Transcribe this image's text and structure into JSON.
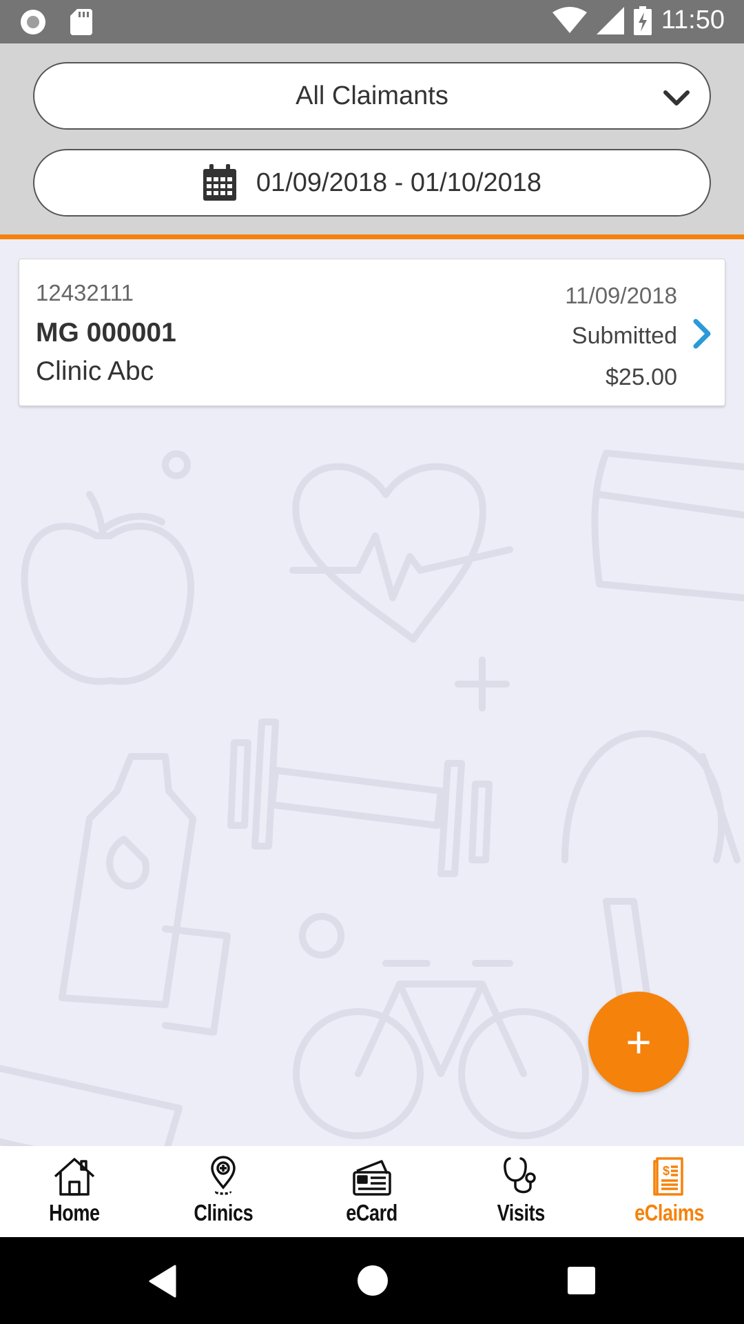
{
  "status_bar": {
    "time": "11:50",
    "left_icons": [
      "record-icon",
      "sd-card-icon"
    ],
    "right_icons": [
      "wifi-icon",
      "signal-icon",
      "battery-charging-icon"
    ]
  },
  "filters": {
    "claimant_selected": "All Claimants",
    "date_range": "01/09/2018 - 01/10/2018"
  },
  "claims": [
    {
      "number": "12432111",
      "code": "MG 000001",
      "clinic": "Clinic Abc",
      "date": "11/09/2018",
      "status": "Submitted",
      "amount": "$25.00"
    }
  ],
  "fab": {
    "label": "+"
  },
  "tabs": [
    {
      "label": "Home",
      "icon": "home-icon",
      "active": false
    },
    {
      "label": "Clinics",
      "icon": "map-pin-icon",
      "active": false
    },
    {
      "label": "eCard",
      "icon": "ecard-icon",
      "active": false
    },
    {
      "label": "Visits",
      "icon": "stethoscope-icon",
      "active": false
    },
    {
      "label": "eClaims",
      "icon": "eclaims-icon",
      "active": true
    }
  ],
  "colors": {
    "accent": "#f5820b",
    "link_arrow": "#2a9ad8",
    "header_bg": "#d4d4d4",
    "status_bar": "#757575",
    "page_bg": "#ecedf6"
  }
}
